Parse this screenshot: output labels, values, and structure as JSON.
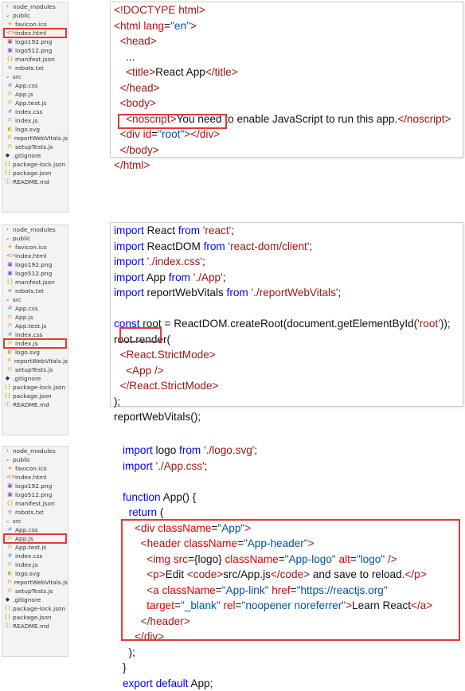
{
  "colors": {
    "tag": "#a31515",
    "attr": "#e50000",
    "string": "#0451a5",
    "keyword": "#0000ff",
    "text": "#111111",
    "highlight": "#e53935",
    "js_icon": "#c7a600",
    "css_icon": "#42a5f5",
    "json_icon": "#c7a600",
    "html_icon": "#e44d26",
    "img_icon": "#7e57c2",
    "star_icon": "#e8b100"
  },
  "explorer": {
    "items": [
      {
        "label": "node_modules",
        "icon": "chevron-right-icon",
        "glyph": "›",
        "depth": 0
      },
      {
        "label": "public",
        "icon": "chevron-down-icon",
        "glyph": "⌄",
        "depth": 0
      },
      {
        "label": "favicon.ico",
        "icon": "star-icon",
        "glyph": "★",
        "depth": 1
      },
      {
        "label": "index.html",
        "icon": "html-icon",
        "glyph": "<>",
        "depth": 1
      },
      {
        "label": "logo192.png",
        "icon": "image-icon",
        "glyph": "▣",
        "depth": 1
      },
      {
        "label": "logo512.png",
        "icon": "image-icon",
        "glyph": "▣",
        "depth": 1
      },
      {
        "label": "manifest.json",
        "icon": "json-icon",
        "glyph": "{}",
        "depth": 1
      },
      {
        "label": "robots.txt",
        "icon": "text-file-icon",
        "glyph": "≡",
        "depth": 1
      },
      {
        "label": "src",
        "icon": "chevron-down-icon",
        "glyph": "⌄",
        "depth": 0
      },
      {
        "label": "App.css",
        "icon": "css-icon",
        "glyph": "#",
        "depth": 1
      },
      {
        "label": "App.js",
        "icon": "js-icon",
        "glyph": "JS",
        "depth": 1
      },
      {
        "label": "App.test.js",
        "icon": "js-icon",
        "glyph": "JS",
        "depth": 1
      },
      {
        "label": "index.css",
        "icon": "css-icon",
        "glyph": "#",
        "depth": 1
      },
      {
        "label": "index.js",
        "icon": "js-icon",
        "glyph": "JS",
        "depth": 1
      },
      {
        "label": "logo.svg",
        "icon": "svg-icon",
        "glyph": "◐",
        "depth": 1
      },
      {
        "label": "reportWebVitals.js",
        "icon": "js-icon",
        "glyph": "JS",
        "depth": 1
      },
      {
        "label": "setupTests.js",
        "icon": "js-icon",
        "glyph": "JS",
        "depth": 1
      },
      {
        "label": ".gitignore",
        "icon": "git-icon",
        "glyph": "◆",
        "depth": 0
      },
      {
        "label": "package-lock.json",
        "icon": "json-icon",
        "glyph": "{}",
        "depth": 0
      },
      {
        "label": "package.json",
        "icon": "json-icon",
        "glyph": "{}",
        "depth": 0
      },
      {
        "label": "README.md",
        "icon": "info-icon",
        "glyph": "ⓘ",
        "depth": 0
      }
    ]
  },
  "panels": [
    {
      "selected_file": "index.html",
      "lines": [
        [
          [
            "t",
            "<!DOCTYPE html>"
          ]
        ],
        [
          [
            "t",
            "<html "
          ],
          [
            "a",
            "lang"
          ],
          [
            "p",
            "="
          ],
          [
            "s",
            "\"en\""
          ],
          [
            "t",
            ">"
          ]
        ],
        [
          [
            "p",
            "  "
          ],
          [
            "t",
            "<head>"
          ]
        ],
        [
          [
            "p",
            "    ..."
          ]
        ],
        [
          [
            "p",
            "    "
          ],
          [
            "t",
            "<title>"
          ],
          [
            "p",
            "React App"
          ],
          [
            "t",
            "</title>"
          ]
        ],
        [
          [
            "p",
            "  "
          ],
          [
            "t",
            "</head>"
          ]
        ],
        [
          [
            "p",
            "  "
          ],
          [
            "t",
            "<body>"
          ]
        ],
        [
          [
            "p",
            "    "
          ],
          [
            "t",
            "<noscript>"
          ],
          [
            "p",
            "You need to enable JavaScript to run this app."
          ],
          [
            "t",
            "</noscript>"
          ]
        ],
        [
          [
            "p",
            "  "
          ],
          [
            "t",
            "<div "
          ],
          [
            "a",
            "id"
          ],
          [
            "p",
            "="
          ],
          [
            "s",
            "\"root\""
          ],
          [
            "t",
            "></div>"
          ]
        ],
        [
          [
            "p",
            "  "
          ],
          [
            "t",
            "</body>"
          ]
        ],
        [
          [
            "t",
            "</html>"
          ]
        ]
      ]
    },
    {
      "selected_file": "index.js",
      "lines": [
        [
          [
            "k",
            "import"
          ],
          [
            "p",
            " React "
          ],
          [
            "k",
            "from"
          ],
          [
            "p",
            " "
          ],
          [
            "t",
            "'react'"
          ],
          [
            "p",
            ";"
          ]
        ],
        [
          [
            "k",
            "import"
          ],
          [
            "p",
            " ReactDOM "
          ],
          [
            "k",
            "from"
          ],
          [
            "p",
            " "
          ],
          [
            "t",
            "'react-dom/client'"
          ],
          [
            "p",
            ";"
          ]
        ],
        [
          [
            "k",
            "import"
          ],
          [
            "p",
            " "
          ],
          [
            "t",
            "'./index.css'"
          ],
          [
            "p",
            ";"
          ]
        ],
        [
          [
            "k",
            "import"
          ],
          [
            "p",
            " App "
          ],
          [
            "k",
            "from"
          ],
          [
            "p",
            " "
          ],
          [
            "t",
            "'./App'"
          ],
          [
            "p",
            ";"
          ]
        ],
        [
          [
            "k",
            "import"
          ],
          [
            "p",
            " reportWebVitals "
          ],
          [
            "k",
            "from"
          ],
          [
            "p",
            " "
          ],
          [
            "t",
            "'./reportWebVitals'"
          ],
          [
            "p",
            ";"
          ]
        ],
        [
          [
            "p",
            ""
          ]
        ],
        [
          [
            "k",
            "const"
          ],
          [
            "p",
            " root = ReactDOM.createRoot(document.getElementById("
          ],
          [
            "t",
            "'root'"
          ],
          [
            "p",
            "));"
          ]
        ],
        [
          [
            "p",
            "root.render("
          ]
        ],
        [
          [
            "p",
            "  "
          ],
          [
            "t",
            "<React.StrictMode>"
          ]
        ],
        [
          [
            "p",
            "    "
          ],
          [
            "t",
            "<App />"
          ]
        ],
        [
          [
            "p",
            "  "
          ],
          [
            "t",
            "</React.StrictMode>"
          ]
        ],
        [
          [
            "p",
            ");"
          ]
        ],
        [
          [
            "p",
            "reportWebVitals();"
          ]
        ]
      ]
    },
    {
      "selected_file": "App.js",
      "lines": [
        [
          [
            "k",
            "import"
          ],
          [
            "p",
            " logo "
          ],
          [
            "k",
            "from"
          ],
          [
            "p",
            " "
          ],
          [
            "t",
            "'./logo.svg'"
          ],
          [
            "p",
            ";"
          ]
        ],
        [
          [
            "k",
            "import"
          ],
          [
            "p",
            " "
          ],
          [
            "t",
            "'./App.css'"
          ],
          [
            "p",
            ";"
          ]
        ],
        [
          [
            "p",
            ""
          ]
        ],
        [
          [
            "k",
            "function"
          ],
          [
            "p",
            " App() {"
          ]
        ],
        [
          [
            "p",
            "  "
          ],
          [
            "k",
            "return"
          ],
          [
            "p",
            " ("
          ]
        ],
        [
          [
            "p",
            "    "
          ],
          [
            "t",
            "<div "
          ],
          [
            "a",
            "className"
          ],
          [
            "p",
            "="
          ],
          [
            "s",
            "\"App\""
          ],
          [
            "t",
            ">"
          ]
        ],
        [
          [
            "p",
            "      "
          ],
          [
            "t",
            "<header "
          ],
          [
            "a",
            "className"
          ],
          [
            "p",
            "="
          ],
          [
            "s",
            "\"App-header\""
          ],
          [
            "t",
            ">"
          ]
        ],
        [
          [
            "p",
            "        "
          ],
          [
            "t",
            "<img "
          ],
          [
            "a",
            "src"
          ],
          [
            "p",
            "={logo} "
          ],
          [
            "a",
            "className"
          ],
          [
            "p",
            "="
          ],
          [
            "s",
            "\"App-logo\""
          ],
          [
            "p",
            " "
          ],
          [
            "a",
            "alt"
          ],
          [
            "p",
            "="
          ],
          [
            "s",
            "\"logo\""
          ],
          [
            "p",
            " "
          ],
          [
            "t",
            "/>"
          ]
        ],
        [
          [
            "p",
            "        "
          ],
          [
            "t",
            "<p>"
          ],
          [
            "p",
            "Edit "
          ],
          [
            "t",
            "<code>"
          ],
          [
            "p",
            "src/App.js"
          ],
          [
            "t",
            "</code>"
          ],
          [
            "p",
            " and save to reload."
          ],
          [
            "t",
            "</p>"
          ]
        ],
        [
          [
            "p",
            "        "
          ],
          [
            "t",
            "<a "
          ],
          [
            "a",
            "className"
          ],
          [
            "p",
            "="
          ],
          [
            "s",
            "\"App-link\""
          ],
          [
            "p",
            " "
          ],
          [
            "a",
            "href"
          ],
          [
            "p",
            "="
          ],
          [
            "s",
            "\"https://reactjs.org\""
          ]
        ],
        [
          [
            "p",
            "        "
          ],
          [
            "a",
            "target"
          ],
          [
            "p",
            "="
          ],
          [
            "s",
            "\"_blank\""
          ],
          [
            "p",
            " "
          ],
          [
            "a",
            "rel"
          ],
          [
            "p",
            "="
          ],
          [
            "s",
            "\"noopener noreferrer\""
          ],
          [
            "t",
            ">"
          ],
          [
            "p",
            "Learn React"
          ],
          [
            "t",
            "</a>"
          ]
        ],
        [
          [
            "p",
            "      "
          ],
          [
            "t",
            "</header>"
          ]
        ],
        [
          [
            "p",
            "    "
          ],
          [
            "t",
            "</div>"
          ]
        ],
        [
          [
            "p",
            "  );"
          ]
        ],
        [
          [
            "p",
            "}"
          ]
        ],
        [
          [
            "k",
            "export"
          ],
          [
            "p",
            " "
          ],
          [
            "k",
            "default"
          ],
          [
            "p",
            " App;"
          ]
        ]
      ]
    }
  ]
}
